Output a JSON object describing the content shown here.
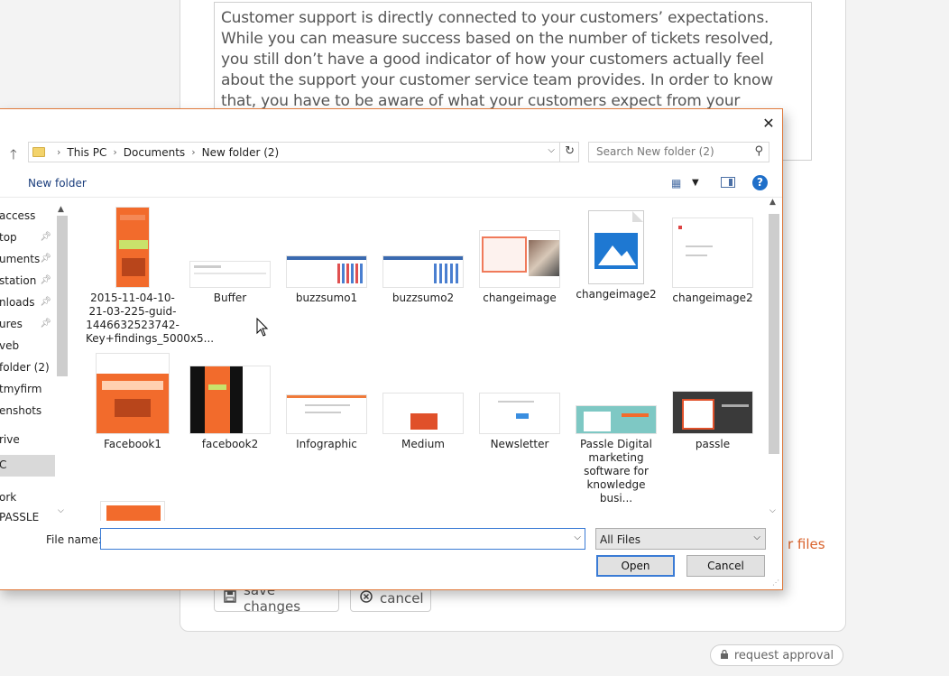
{
  "background": {
    "editor_text": "Customer support is directly connected to your customers’ expectations. While you can measure success based on the number of tickets resolved, you still don’t have a good indicator of how your customers actually feel about the support your customer service team provides. In order to know that, you have to be aware of what your customers expect from your company.",
    "files_link": "r files",
    "save_label": "save changes",
    "cancel_label": "cancel",
    "approval_label": "request approval"
  },
  "dialog": {
    "breadcrumbs": [
      "This PC",
      "Documents",
      "New folder (2)"
    ],
    "search_placeholder": "Search New folder (2)",
    "new_folder_label": "New folder",
    "help_label": "?",
    "nav_items": [
      {
        "label": " access",
        "pinned": false
      },
      {
        "label": "top",
        "pinned": true
      },
      {
        "label": "uments",
        "pinned": true
      },
      {
        "label": "station",
        "pinned": true
      },
      {
        "label": "nloads",
        "pinned": true
      },
      {
        "label": "ures",
        "pinned": true
      },
      {
        "label": "veb",
        "pinned": false
      },
      {
        "label": " folder (2)",
        "pinned": false
      },
      {
        "label": "tmyfirm",
        "pinned": false
      },
      {
        "label": "enshots",
        "pinned": false
      },
      {
        "label": "rive",
        "pinned": false
      },
      {
        "label": "C",
        "pinned": false
      },
      {
        "label": "ork",
        "pinned": false
      },
      {
        "label": "PASSLE",
        "pinned": false
      }
    ],
    "files": [
      {
        "name": "2015-11-04-10-21-03-225-guid-1446632523742-Key+findings_5000x5...",
        "thumb": "infographic-orange"
      },
      {
        "name": "Buffer",
        "thumb": "screenshot"
      },
      {
        "name": "buzzsumo1",
        "thumb": "screenshot-blue"
      },
      {
        "name": "buzzsumo2",
        "thumb": "screenshot-blue"
      },
      {
        "name": "changeimage",
        "thumb": "screenshot-collage"
      },
      {
        "name": "changeimage2",
        "thumb": "image-file-icon"
      },
      {
        "name": "changeimage2",
        "thumb": "screenshot"
      },
      {
        "name": "Facebook1",
        "thumb": "infographic-orange"
      },
      {
        "name": "facebook2",
        "thumb": "infographic-dark"
      },
      {
        "name": "Infographic",
        "thumb": "screenshot"
      },
      {
        "name": "Medium",
        "thumb": "screenshot-orange"
      },
      {
        "name": "Newsletter",
        "thumb": "screenshot"
      },
      {
        "name": "Passle   Digital marketing software for knowledge busi...",
        "thumb": "illustration-teal"
      },
      {
        "name": "passle",
        "thumb": "screenshot-dark"
      },
      {
        "name": "",
        "thumb": "infographic-orange"
      }
    ],
    "file_name_label": "File name:",
    "file_name_value": "",
    "file_type": "All Files",
    "open_label": "Open",
    "cancel_label": "Cancel"
  },
  "colors": {
    "accent_orange": "#d9622b",
    "selection_blue": "#3a7bd5",
    "infographic_orange": "#f26b2c"
  }
}
